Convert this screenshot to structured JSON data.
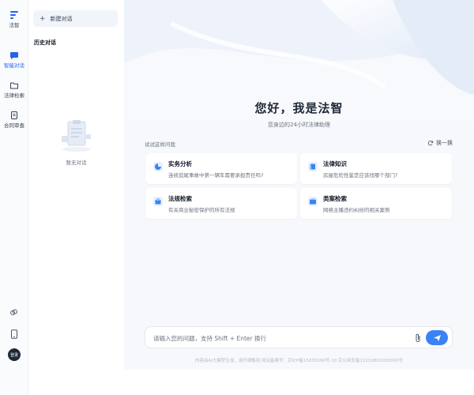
{
  "rail": {
    "items": [
      {
        "label": "法智"
      },
      {
        "label": "智能对话"
      },
      {
        "label": "法律检索"
      },
      {
        "label": "合同审查"
      }
    ],
    "avatar_text": "登录"
  },
  "history": {
    "new_chat_label": "新建对话",
    "title": "历史对话",
    "empty_text": "暂无对话"
  },
  "main": {
    "greeting": "您好，我是法智",
    "subtitle": "您身边的24小时法律助理",
    "suggest_label": "试试这样问我",
    "refresh_label": "换一换",
    "cards": [
      {
        "title": "实务分析",
        "desc": "连续追尾事故中第一辆车需要承担责任吗?"
      },
      {
        "title": "法律知识",
        "desc": "房屋危险性鉴定应该找哪个部门?"
      },
      {
        "title": "法规检索",
        "desc": "有关商业秘密保护的所有法规"
      },
      {
        "title": "类案检索",
        "desc": "网络主播违约纠纷的相关案例"
      }
    ]
  },
  "input": {
    "placeholder": "请输入您的问题，支持 Shift + Enter 换行"
  },
  "footer": {
    "text": "内容由AI大模型生成，请仔细甄别      网站备案号：京ICP备15030290号-10      京公网安备11010802030000号"
  },
  "colors": {
    "accent": "#3b82f6",
    "active_label": "#2563eb"
  }
}
